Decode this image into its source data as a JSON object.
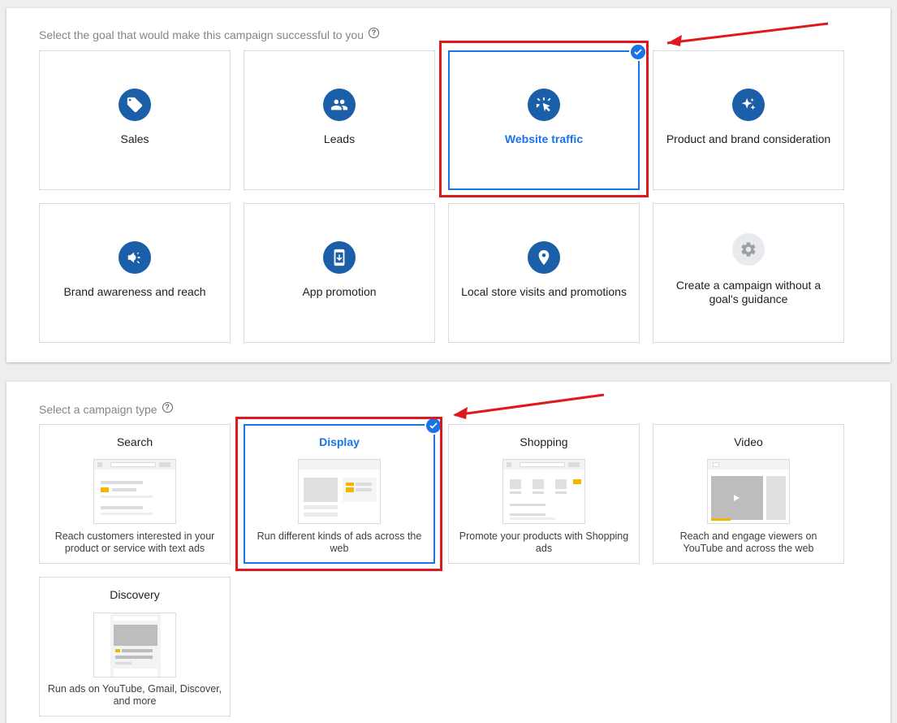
{
  "goal_section": {
    "label": "Select the goal that would make this campaign successful to you",
    "help_icon_glyph": "?",
    "goals": [
      {
        "label": "Sales",
        "icon": "tag-icon",
        "selected": false
      },
      {
        "label": "Leads",
        "icon": "people-icon",
        "selected": false
      },
      {
        "label": "Website traffic",
        "icon": "cursor-click-icon",
        "selected": true
      },
      {
        "label": "Product and brand consideration",
        "icon": "sparkle-icon",
        "selected": false
      },
      {
        "label": "Brand awareness and reach",
        "icon": "megaphone-icon",
        "selected": false
      },
      {
        "label": "App promotion",
        "icon": "phone-download-icon",
        "selected": false
      },
      {
        "label": "Local store visits and promotions",
        "icon": "location-pin-icon",
        "selected": false
      },
      {
        "label": "Create a campaign without a goal's guidance",
        "icon": "gear-icon",
        "selected": false
      }
    ]
  },
  "type_section": {
    "label": "Select a campaign type",
    "help_icon_glyph": "?",
    "types": [
      {
        "title": "Search",
        "description": "Reach customers interested in your product or service with text ads",
        "selected": false
      },
      {
        "title": "Display",
        "description": "Run different kinds of ads across the web",
        "selected": true
      },
      {
        "title": "Shopping",
        "description": "Promote your products with Shopping ads",
        "selected": false
      },
      {
        "title": "Video",
        "description": "Reach and engage viewers on YouTube and across the web",
        "selected": false
      },
      {
        "title": "Discovery",
        "description": "Run ads on YouTube, Gmail, Discover, and more",
        "selected": false
      }
    ]
  },
  "colors": {
    "accent": "#1a73e8",
    "icon_circle": "#1a5fa8",
    "annotation_red": "#e0181e",
    "ad_yellow": "#f4b400"
  }
}
